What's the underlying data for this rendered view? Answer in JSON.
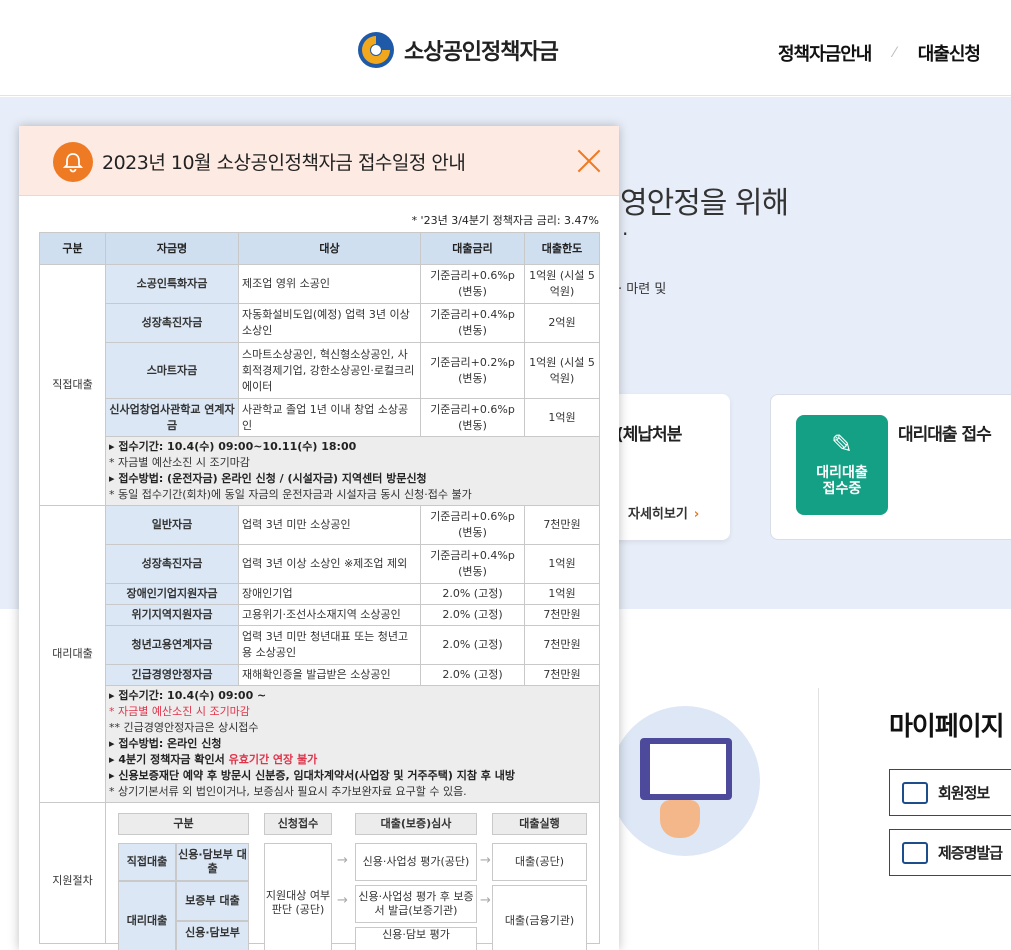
{
  "header": {
    "logo_text": "소상공인정책자금",
    "nav": [
      "정책자금안내",
      "대출신청"
    ]
  },
  "background": {
    "hero_title": "영안정을 위해",
    "hero_dot": "·",
    "hero_sub": "· 마련 및",
    "card1_title": "(체납처분",
    "card1_more": "자세히보기",
    "card2_badge": "대리대출\n접수중",
    "card2_title": "대리대출 접수",
    "mypage_title": "마이페이지",
    "mypage_buttons": [
      "회원정보",
      "제증명발급"
    ]
  },
  "popup": {
    "title": "2023년 10월 소상공인정책자금 접수일정 안내",
    "rate_note": "* '23년 3/4분기 정책자금 금리: 3.47%",
    "columns": [
      "구분",
      "자금명",
      "대상",
      "대출금리",
      "대출한도"
    ],
    "direct": {
      "category": "직접대출",
      "rows": [
        {
          "name": "소공인특화자금",
          "target": "제조업 영위 소공인",
          "rate": "기준금리+0.6%p (변동)",
          "limit": "1억원 (시설 5억원)"
        },
        {
          "name": "성장촉진자금",
          "target": "자동화설비도입(예정) 업력 3년 이상 소상인",
          "rate": "기준금리+0.4%p (변동)",
          "limit": "2억원"
        },
        {
          "name": "스마트자금",
          "target": "스마트소상공인, 혁신형소상공인, 사회적경제기업, 강한소상공인·로컬크리에이터",
          "rate": "기준금리+0.2%p (변동)",
          "limit": "1억원 (시설 5억원)"
        },
        {
          "name": "신사업창업사관학교 연계자금",
          "target": "사관학교 졸업 1년 이내 창업 소상공인",
          "rate": "기준금리+0.6%p (변동)",
          "limit": "1억원"
        }
      ],
      "notes": [
        "▸ 접수기간: 10.4(수) 09:00~10.11(수) 18:00",
        "* 자금별 예산소진 시 조기마감",
        "▸ 접수방법: (운전자금) 온라인 신청 / (시설자금) 지역센터 방문신청",
        "* 동일 접수기간(회차)에 동일 자금의 운전자금과 시설자금 동시 신청·접수 불가"
      ]
    },
    "agency": {
      "category": "대리대출",
      "rows": [
        {
          "name": "일반자금",
          "target": "업력 3년 미만 소상공인",
          "rate": "기준금리+0.6%p (변동)",
          "limit": "7천만원"
        },
        {
          "name": "성장촉진자금",
          "target": "업력 3년 이상 소상인 ※제조업 제외",
          "rate": "기준금리+0.4%p (변동)",
          "limit": "1억원"
        },
        {
          "name": "장애인기업지원자금",
          "target": "장애인기업",
          "rate": "2.0% (고정)",
          "limit": "1억원"
        },
        {
          "name": "위기지역지원자금",
          "target": "고용위기·조선사소재지역 소상공인",
          "rate": "2.0% (고정)",
          "limit": "7천만원"
        },
        {
          "name": "청년고용연계자금",
          "target": "업력 3년 미만 청년대표 또는 청년고용 소상공인",
          "rate": "2.0% (고정)",
          "limit": "7천만원"
        },
        {
          "name": "긴급경영안정자금",
          "target": "재해확인증을 발급받은 소상공인",
          "rate": "2.0% (고정)",
          "limit": "7천만원"
        }
      ],
      "notes": {
        "period": "▸ 접수기간: 10.4(수) 09:00 ~",
        "early": "* 자금별 예산소진 시 조기마감",
        "emergency": "** 긴급경영안정자금은 상시접수",
        "method": "▸ 접수방법: 온라인 신청",
        "confirm_a": "▸ 4분기 정책자금 확인서 ",
        "confirm_b": "유효기간 연장 불가",
        "guarantee": "▸ 신용보증재단 예약 후 방문시 신분증, 임대차계약서(사업장 및 거주주택) 지참 후 내방",
        "extra": "* 상기기본서류 외 법인이거나, 보증심사 필요시 추가보완자료 요구할 수 있음."
      }
    },
    "procedure": {
      "category": "지원절차",
      "headers": [
        "구분",
        "신청접수",
        "대출(보증)심사",
        "대출실행"
      ],
      "direct_label": "직접대출",
      "direct_type": "신용·담보부 대출",
      "agency_label": "대리대출",
      "agency_type1": "보증부 대출",
      "agency_type2": "신용·담보부",
      "apply": "지원대상 여부 판단 (공단)",
      "review1": "신용·사업성 평가(공단)",
      "review2": "신용·사업성 평가 후 보증서 발급(보증기관)",
      "review3": "신용·담보 평가",
      "exec1": "대출(공단)",
      "exec2": "대출(금융기관)"
    }
  }
}
